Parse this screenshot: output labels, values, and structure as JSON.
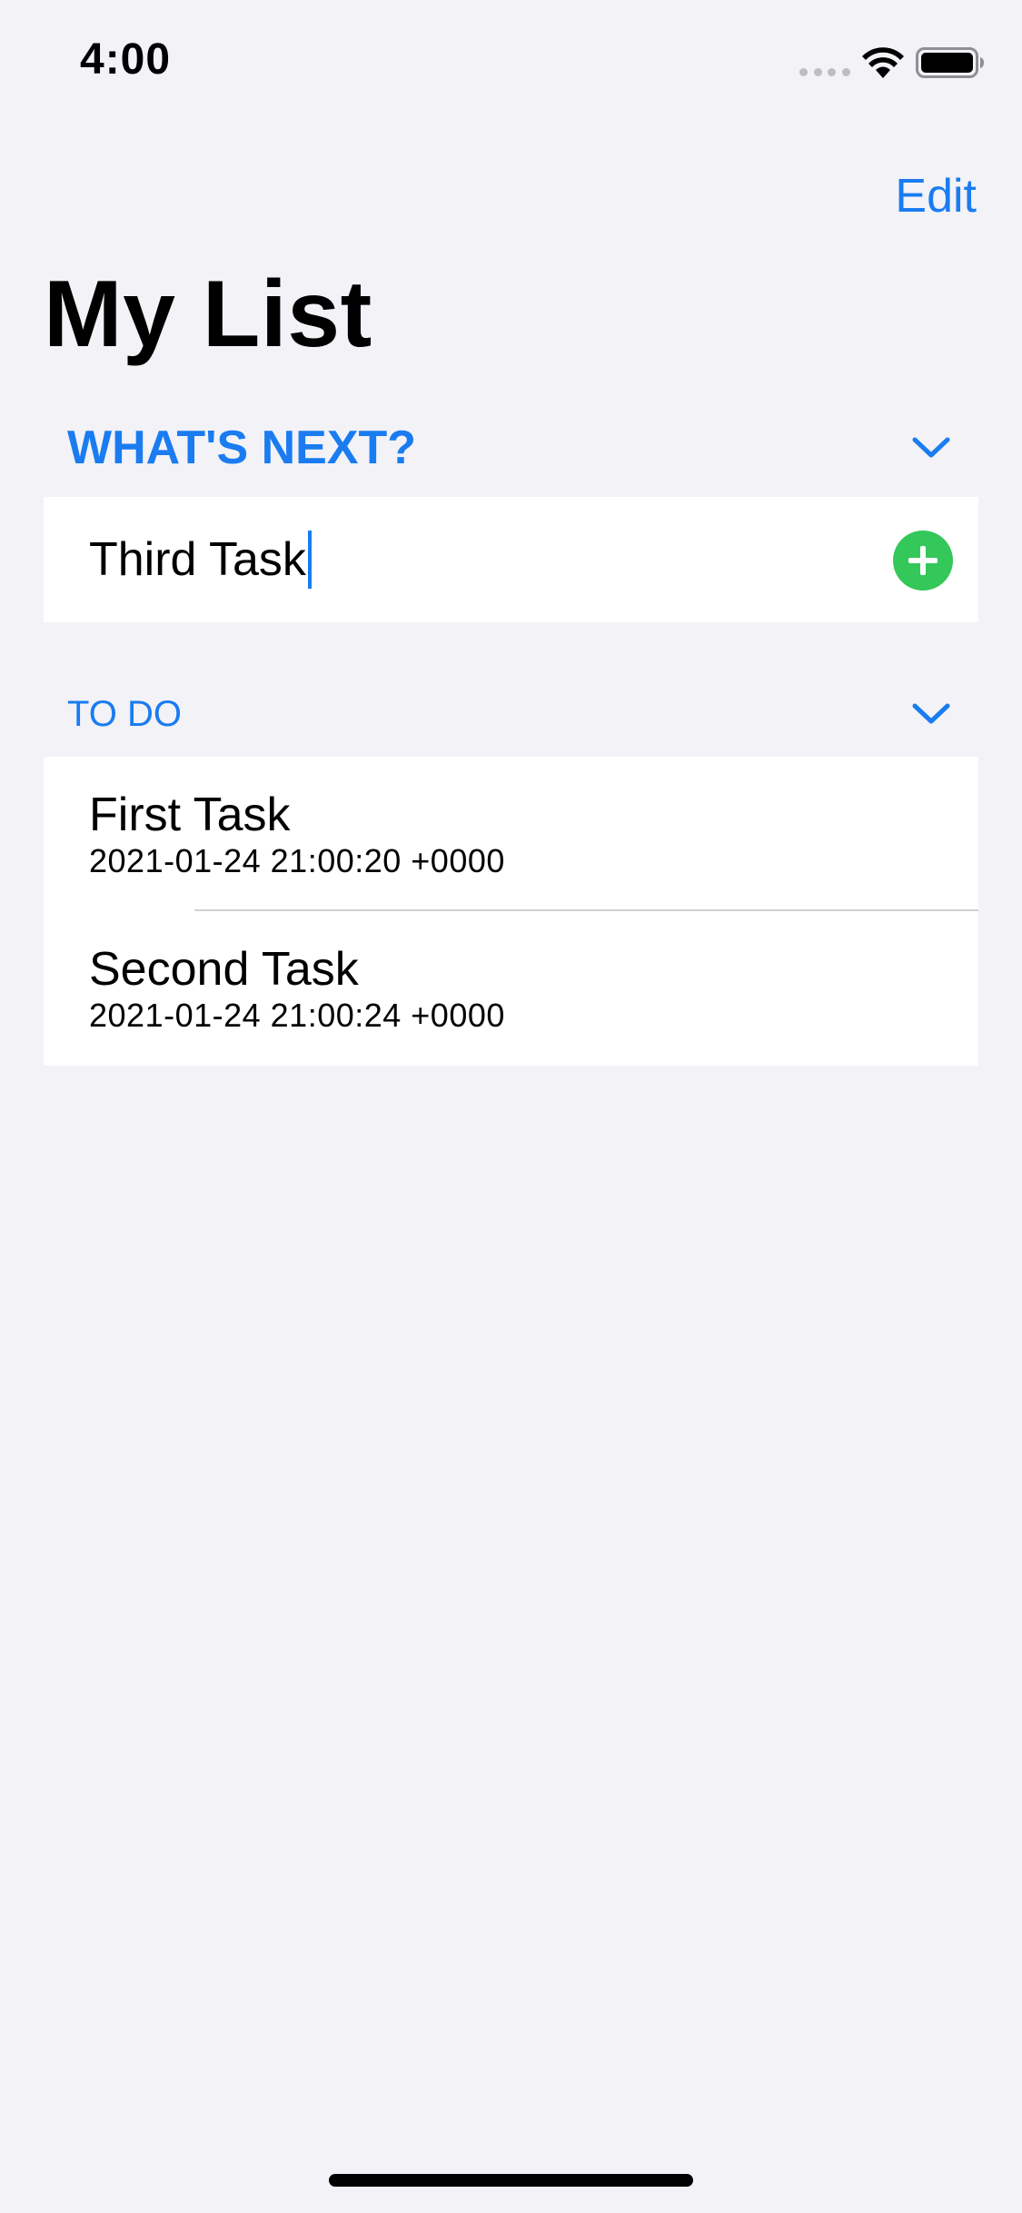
{
  "status_bar": {
    "time": "4:00",
    "icons": [
      "signal-dots-icon",
      "wifi-icon",
      "battery-icon"
    ]
  },
  "nav": {
    "edit_label": "Edit",
    "title": "My List"
  },
  "whats_next_section": {
    "header": "WHAT'S NEXT?",
    "input_value": "Third Task",
    "add_icon": "plus-circle-icon"
  },
  "todo_section": {
    "header": "TO DO",
    "items": [
      {
        "title": "First Task",
        "date": "2021-01-24 21:00:20 +0000"
      },
      {
        "title": "Second Task",
        "date": "2021-01-24 21:00:24 +0000"
      }
    ]
  },
  "colors": {
    "accent": "#1A7CF0",
    "add_button": "#34C759",
    "background": "#F2F2F7"
  }
}
